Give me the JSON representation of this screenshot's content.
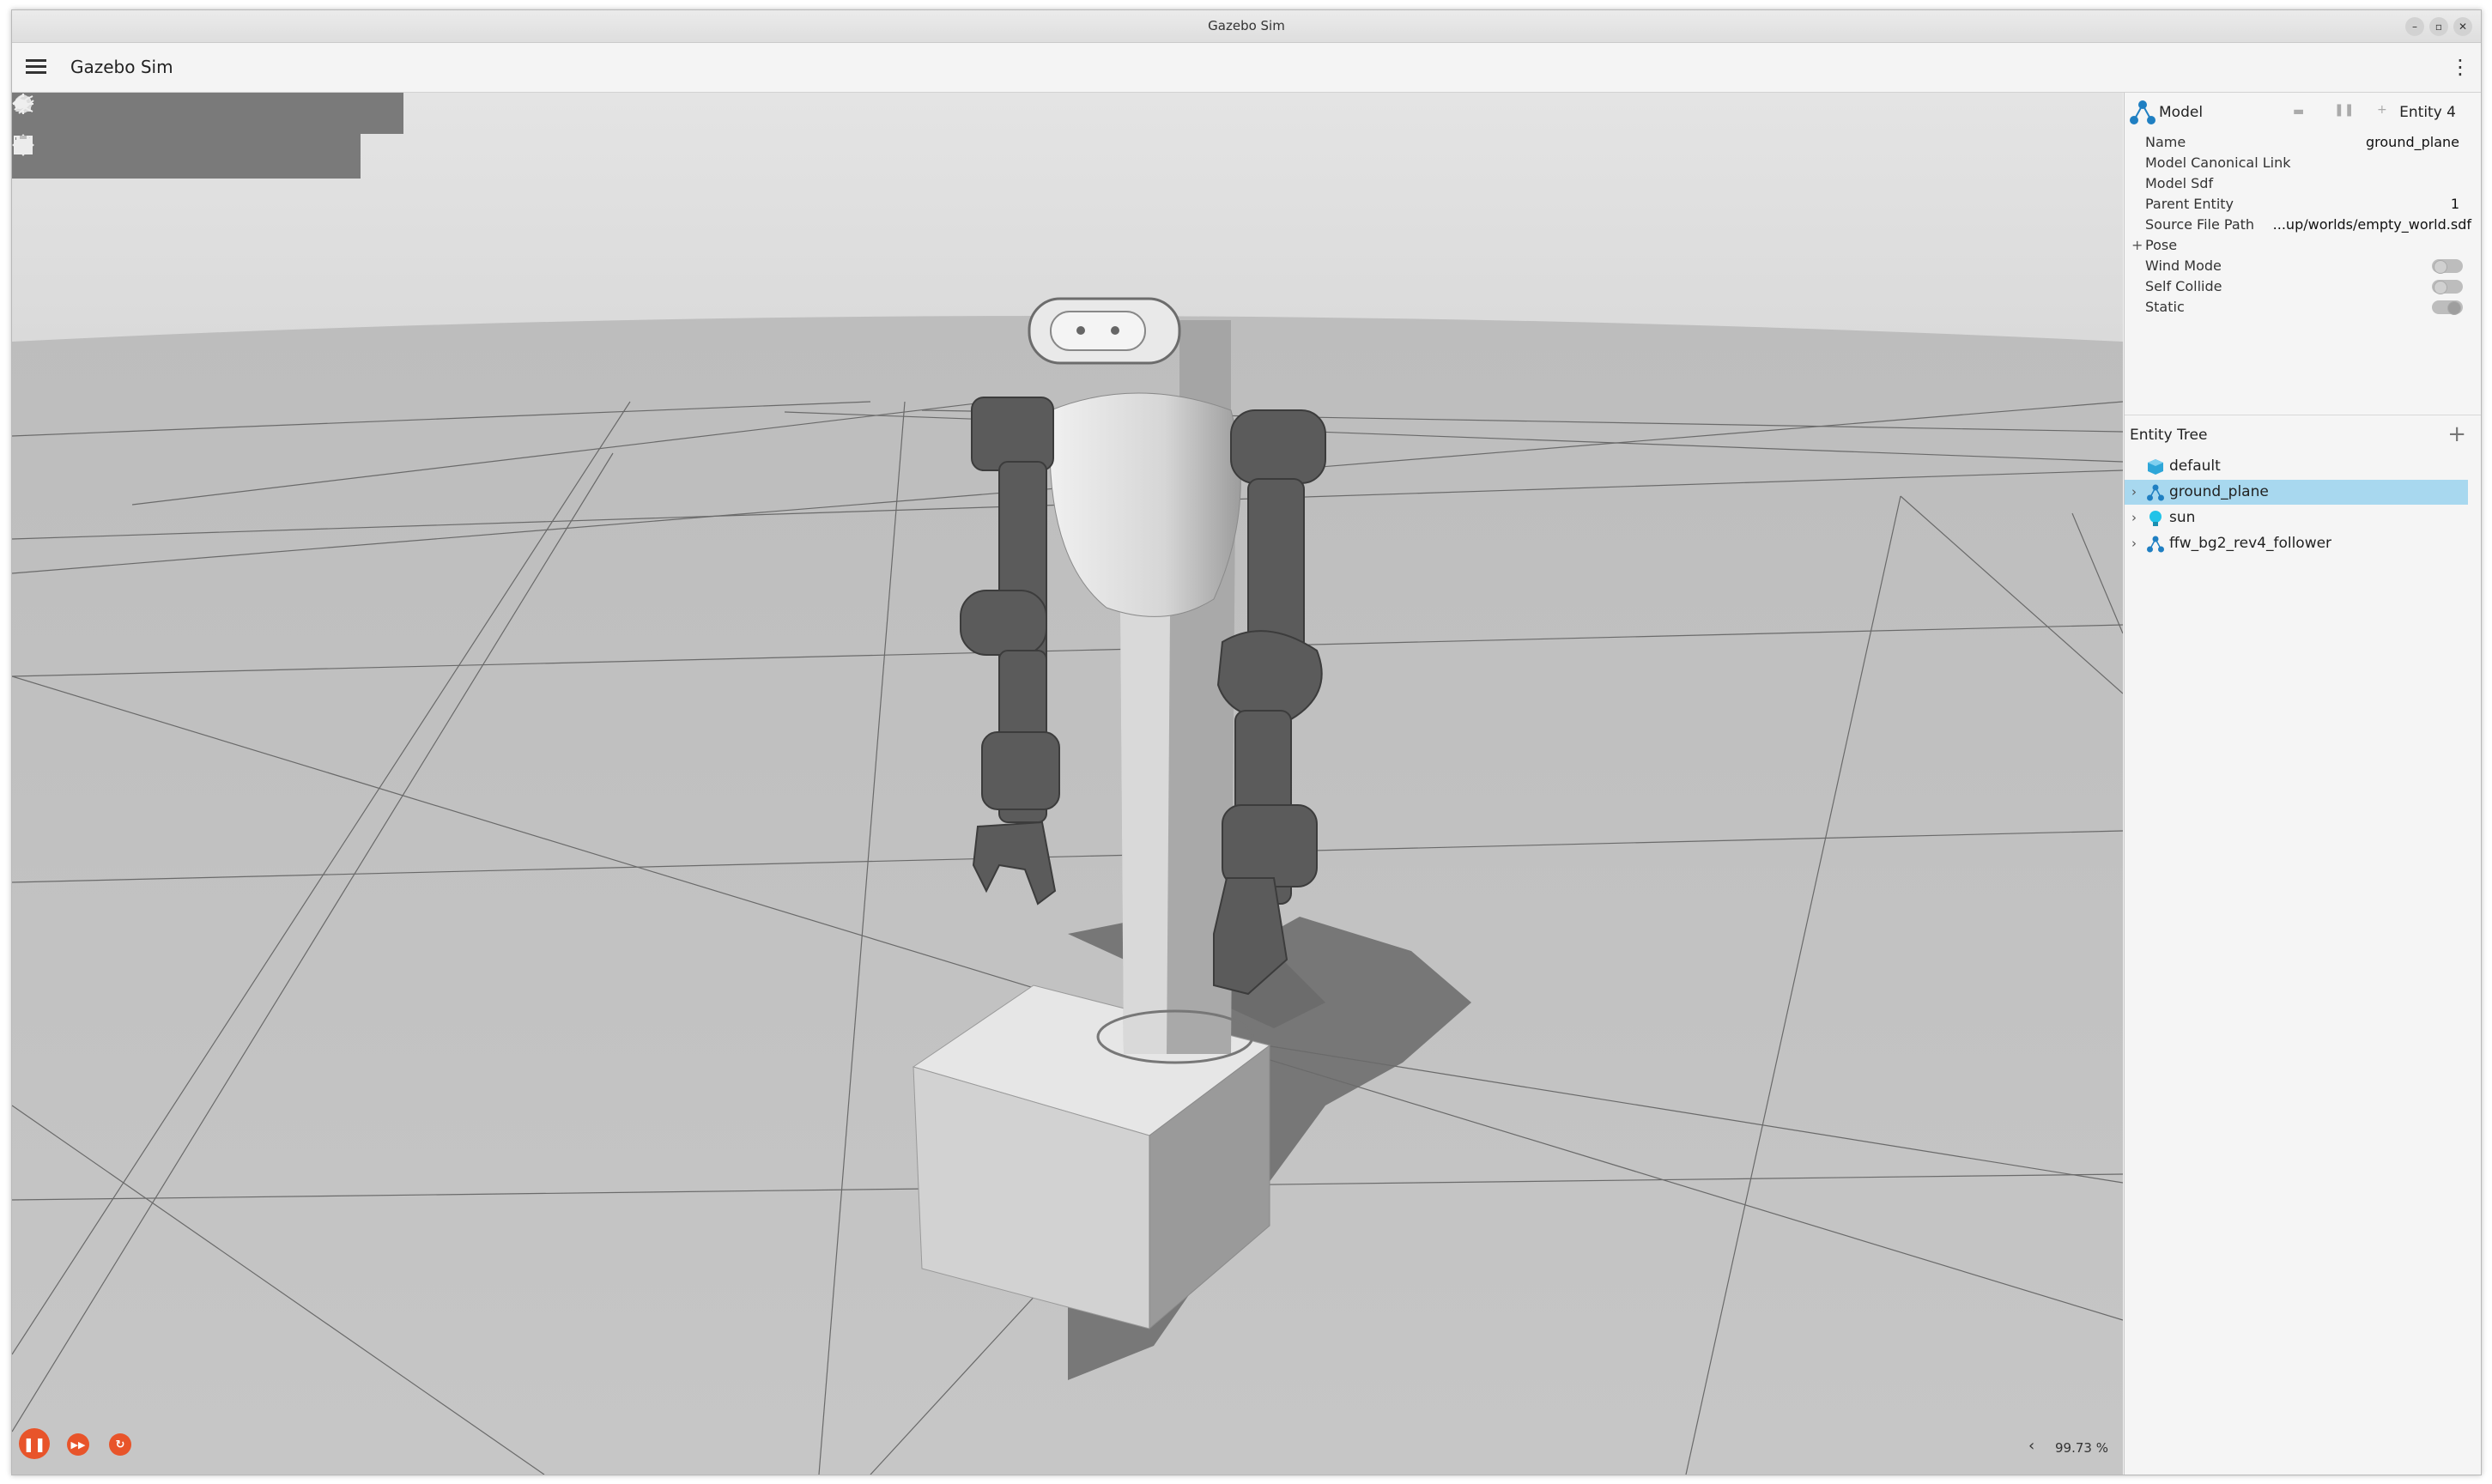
{
  "window": {
    "title": "Gazebo Sim"
  },
  "menubar": {
    "app_title": "Gazebo Sim"
  },
  "toolbar_top": {
    "tools": [
      "box-icon",
      "sphere-icon",
      "cone-icon",
      "cylinder-icon",
      "capsule-icon",
      "ellipsoid-icon",
      "point-light-icon",
      "directional-light-icon",
      "spot-light-icon"
    ]
  },
  "toolbar_bottom": {
    "tools": [
      "select-icon",
      "translate-icon",
      "rotate-icon",
      "snap-icon",
      "grid-icon",
      "camera-icon",
      "copy-icon",
      "paste-icon"
    ]
  },
  "playback": {
    "real_time_factor": "99.73 %"
  },
  "component_inspector": {
    "type_label": "Model",
    "entity_label": "Entity 4",
    "properties": [
      {
        "key": "Name",
        "value": "ground_plane"
      },
      {
        "key": "Model Canonical Link",
        "value": ""
      },
      {
        "key": "Model Sdf",
        "value": ""
      },
      {
        "key": "Parent Entity",
        "value": "1"
      },
      {
        "key": "Source File Path",
        "value": "...up/worlds/empty_world.sdf"
      },
      {
        "key": "Pose",
        "value": "",
        "prefix": "+"
      },
      {
        "key": "Wind Mode",
        "value": "",
        "toggle": false
      },
      {
        "key": "Self Collide",
        "value": "",
        "toggle": false
      },
      {
        "key": "Static",
        "value": "",
        "toggle": true
      }
    ]
  },
  "entity_tree": {
    "title": "Entity Tree",
    "items": [
      {
        "name": "default",
        "icon": "world-cube-icon",
        "expandable": false,
        "selected": false
      },
      {
        "name": "ground_plane",
        "icon": "model-icon",
        "expandable": true,
        "selected": true
      },
      {
        "name": "sun",
        "icon": "light-bulb-icon",
        "expandable": true,
        "selected": false
      },
      {
        "name": "ffw_bg2_rev4_follower",
        "icon": "model-icon",
        "expandable": true,
        "selected": false
      }
    ]
  },
  "colors": {
    "accent": "#e8542a",
    "selection": "#a8d8ef",
    "toolbar": "#7a7a7a"
  }
}
